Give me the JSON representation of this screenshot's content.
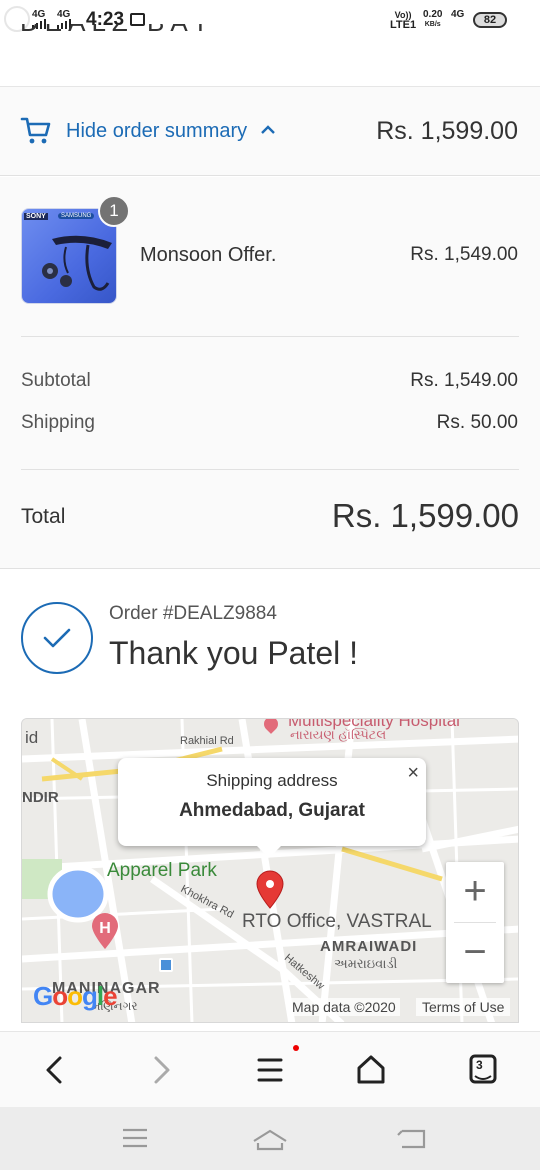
{
  "status_bar": {
    "network1": "4G",
    "network2": "4G",
    "time": "4:23",
    "volte_top": "Vo))",
    "volte_bottom": "LTE1",
    "speed_value": "0.20",
    "speed_unit": "KB/s",
    "network3": "4G",
    "battery": "82"
  },
  "header": {
    "cut_title": "DEALZ BAY"
  },
  "order_summary_toggle": {
    "label": "Hide order summary",
    "total": "Rs. 1,599.00",
    "icon": "cart-icon"
  },
  "product": {
    "name": "Monsoon Offer.",
    "price": "Rs. 1,549.00",
    "quantity": "1",
    "image_brand1": "SONY",
    "image_brand2": "SAMSUNG"
  },
  "costs": {
    "subtotal_label": "Subtotal",
    "subtotal_value": "Rs. 1,549.00",
    "shipping_label": "Shipping",
    "shipping_value": "Rs. 50.00",
    "total_label": "Total",
    "total_value": "Rs. 1,599.00"
  },
  "confirmation": {
    "order_number": "Order #DEALZ9884",
    "thank_you": "Thank you Patel !"
  },
  "map": {
    "popup_title": "Shipping address",
    "popup_address": "Ahmedabad, Gujarat",
    "close_symbol": "×",
    "zoom_in": "+",
    "zoom_out": "−",
    "labels": {
      "hospital_en": "Multispeciality Hospital",
      "hospital_gu": "નારાયણ હૉસ્પિટલ",
      "rakhial_rd": "Rakhial Rd",
      "id": "id",
      "ndir": "NDIR",
      "apparel_park": "Apparel Park",
      "khokhra_rd": "Khokhra Rd",
      "rto": "RTO Office, VASTRAL",
      "amraiwadi_en": "AMRAIWADI",
      "amraiwadi_gu": "અમરાઇવાડી",
      "hatkeshwar": "Hatkeshw",
      "maninagar": "MANINAGAR",
      "maninagar_gu": "મણિનગર"
    },
    "google_logo": "Google",
    "map_data": "Map data ©2020",
    "terms": "Terms of Use"
  },
  "browser_bar": {
    "tab_count": "3"
  },
  "colors": {
    "accent": "#1c6bb5",
    "marker": "#e53935",
    "text": "#333333"
  }
}
